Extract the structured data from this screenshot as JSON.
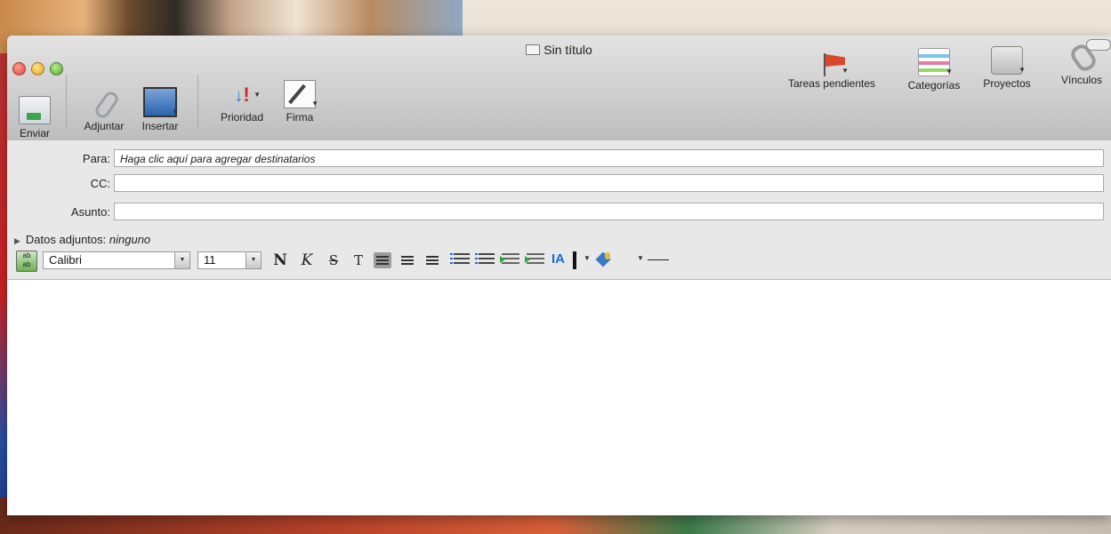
{
  "window": {
    "title": "Sin título"
  },
  "toolbar": {
    "left_items": [
      {
        "label": "Enviar",
        "icon": "send-icon"
      },
      {
        "label": "Adjuntar",
        "icon": "paperclip-icon"
      },
      {
        "label": "Insertar",
        "icon": "insert-picture-icon"
      },
      {
        "label": "Prioridad",
        "icon": "priority-icon"
      },
      {
        "label": "Firma",
        "icon": "signature-icon"
      }
    ],
    "right_items": [
      {
        "label": "Tareas pendientes",
        "icon": "flag-icon"
      },
      {
        "label": "Categorías",
        "icon": "categories-icon"
      },
      {
        "label": "Proyectos",
        "icon": "projects-icon"
      },
      {
        "label": "Vínculos",
        "icon": "links-icon"
      }
    ]
  },
  "headers": {
    "to_label": "Para:",
    "to_placeholder": "Haga clic aquí para agregar destinatarios",
    "cc_label": "CC:",
    "cc_value": "",
    "subject_label": "Asunto:",
    "subject_value": "",
    "attachments_label": "Datos adjuntos:",
    "attachments_value": "ninguno"
  },
  "format": {
    "font_name": "Calibri",
    "font_size": "11",
    "bold_label": "N",
    "italic_label": "K",
    "strike_label": "S",
    "t_label": "T",
    "ia_label": "IA"
  },
  "colors": {
    "close": "#e0443a",
    "minimize": "#e6a21c",
    "zoom": "#4ea82c",
    "flag": "#d8482a"
  }
}
